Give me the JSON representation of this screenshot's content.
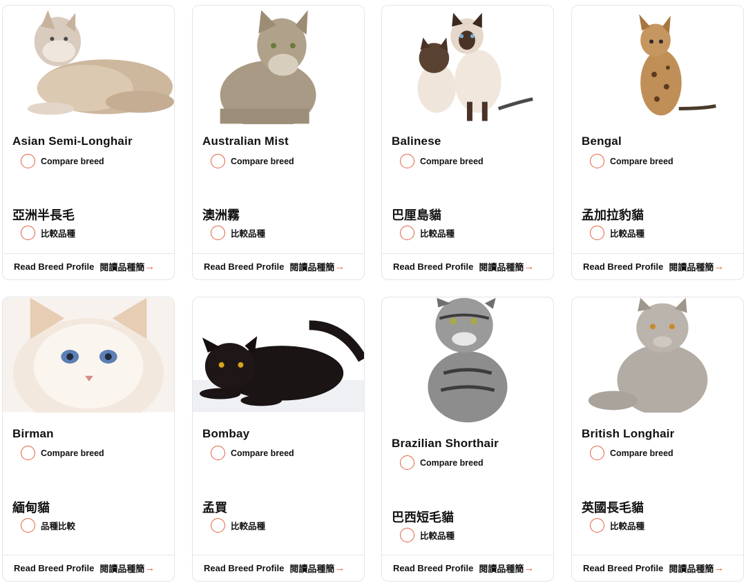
{
  "breeds": [
    {
      "name_en": "Asian Semi-Longhair",
      "compare_en": "Compare breed",
      "name_zh": "亞洲半長毛",
      "compare_zh": "比較品種",
      "read_en": "Read Breed Profile",
      "read_zh": "閱讀品種簡",
      "arrow": "→",
      "image": "cream-longhair-cat-lying-image",
      "fur": "#cbb8a0"
    },
    {
      "name_en": "Australian Mist",
      "compare_en": "Compare breed",
      "name_zh": "澳洲霧",
      "compare_zh": "比較品種",
      "read_en": "Read Breed Profile",
      "read_zh": "閱讀品種簡",
      "arrow": "→",
      "image": "spotted-tabby-cat-sitting-image",
      "fur": "#a39680"
    },
    {
      "name_en": "Balinese",
      "compare_en": "Compare breed",
      "name_zh": "巴厘島貓",
      "compare_zh": "比較品種",
      "read_en": "Read Breed Profile",
      "read_zh": "閱讀品種簡",
      "arrow": "→",
      "image": "two-colorpoint-cats-image",
      "fur": "#e9ddd0"
    },
    {
      "name_en": "Bengal",
      "compare_en": "Compare breed",
      "name_zh": "孟加拉豹貓",
      "compare_zh": "比較品種",
      "read_en": "Read Breed Profile",
      "read_zh": "閱讀品種簡",
      "arrow": "→",
      "image": "leopard-spotted-kitten-image",
      "fur": "#b98a52"
    },
    {
      "name_en": "Birman",
      "compare_en": "Compare breed",
      "name_zh": "緬甸貓",
      "compare_zh": "品種比較",
      "read_en": "Read Breed Profile",
      "read_zh": "閱讀品種簡",
      "arrow": "→",
      "image": "white-fluffy-blue-eyed-cat-image",
      "fur": "#f1e6da"
    },
    {
      "name_en": "Bombay",
      "compare_en": "Compare breed",
      "name_zh": "孟買",
      "compare_zh": "比較品種",
      "read_en": "Read Breed Profile",
      "read_zh": "閱讀品種簡",
      "arrow": "→",
      "image": "black-cat-crouching-image",
      "fur": "#1b1414"
    },
    {
      "name_en": "Brazilian Shorthair",
      "compare_en": "Compare breed",
      "name_zh": "巴西短毛貓",
      "compare_zh": "比較品種",
      "read_en": "Read Breed Profile",
      "read_zh": "閱讀品種簡",
      "arrow": "→",
      "image": "silver-tabby-cat-sitting-image",
      "fur": "#8d8d8d"
    },
    {
      "name_en": "British Longhair",
      "compare_en": "Compare breed",
      "name_zh": "英國長毛貓",
      "compare_zh": "比較品種",
      "read_en": "Read Breed Profile",
      "read_zh": "閱讀品種簡",
      "arrow": "→",
      "image": "grey-longhair-cat-sitting-image",
      "fur": "#b3aca4"
    }
  ],
  "colors": {
    "accent": "#e2603f",
    "border": "#e4e4e4"
  }
}
